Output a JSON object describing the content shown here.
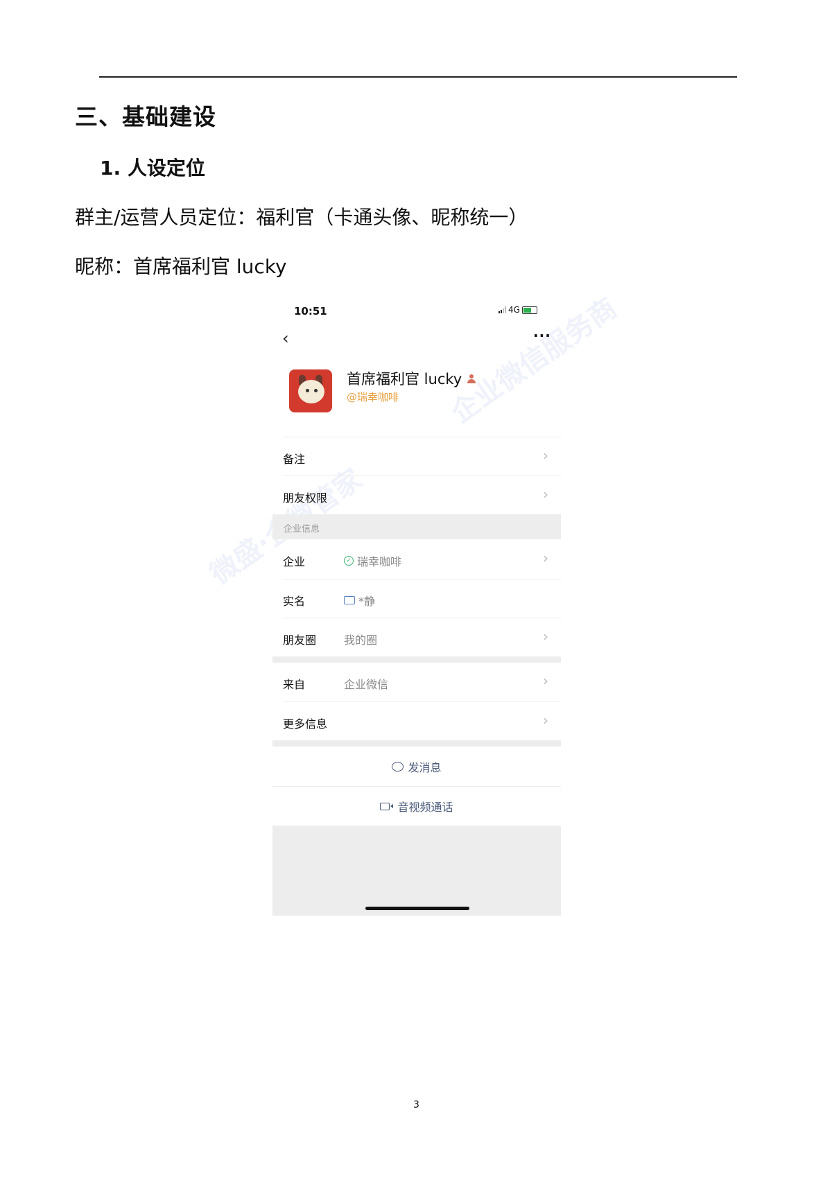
{
  "doc": {
    "section_title": "三、基础建设",
    "subsection_title": "1. 人设定位",
    "para1": "群主/运营人员定位：福利官（卡通头像、昵称统一）",
    "para2": "昵称：首席福利官 lucky",
    "page_number": "3"
  },
  "phone": {
    "status": {
      "time": "10:51",
      "network": "4G"
    },
    "profile": {
      "name": "首席福利官 lucky",
      "org": "@瑞幸咖啡"
    },
    "rows": {
      "remark": {
        "label": "备注"
      },
      "friend_perm": {
        "label": "朋友权限"
      },
      "section_label": "企业信息",
      "company": {
        "label": "企业",
        "value": "瑞幸咖啡"
      },
      "realname": {
        "label": "实名",
        "value": "*静"
      },
      "moments": {
        "label": "朋友圈",
        "value": "我的圈"
      },
      "from": {
        "label": "来自",
        "value": "企业微信"
      },
      "more_info": {
        "label": "更多信息"
      }
    },
    "actions": {
      "send_message": "发消息",
      "av_call": "音视频通话"
    },
    "watermarks": [
      "微盛·企微管家",
      "企业微信服务商"
    ]
  }
}
